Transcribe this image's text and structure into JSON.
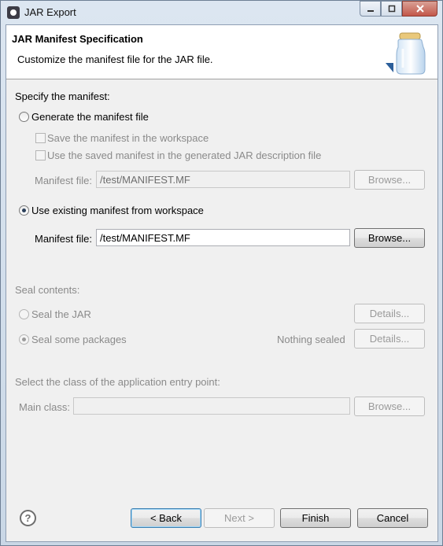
{
  "window": {
    "title": "JAR Export"
  },
  "header": {
    "title": "JAR Manifest Specification",
    "description": "Customize the manifest file for the JAR file."
  },
  "manifest": {
    "section_label": "Specify the manifest:",
    "generate_label": "Generate the manifest file",
    "save_in_workspace_label": "Save the manifest in the workspace",
    "use_saved_label": "Use the saved manifest in the generated JAR description file",
    "generate_file_label": "Manifest file:",
    "generate_file_value": "/test/MANIFEST.MF",
    "generate_browse_label": "Browse...",
    "use_existing_label": "Use existing manifest from workspace",
    "existing_file_label": "Manifest file:",
    "existing_file_value": "/test/MANIFEST.MF",
    "existing_browse_label": "Browse..."
  },
  "seal": {
    "section_label": "Seal contents:",
    "seal_jar_label": "Seal the JAR",
    "seal_jar_details_label": "Details...",
    "seal_packages_label": "Seal some packages",
    "seal_status": "Nothing sealed",
    "seal_packages_details_label": "Details..."
  },
  "entry_point": {
    "section_label": "Select the class of the application entry point:",
    "main_class_label": "Main class:",
    "main_class_value": "",
    "browse_label": "Browse..."
  },
  "footer": {
    "back_label": "< Back",
    "next_label": "Next >",
    "finish_label": "Finish",
    "cancel_label": "Cancel",
    "help_glyph": "?"
  }
}
